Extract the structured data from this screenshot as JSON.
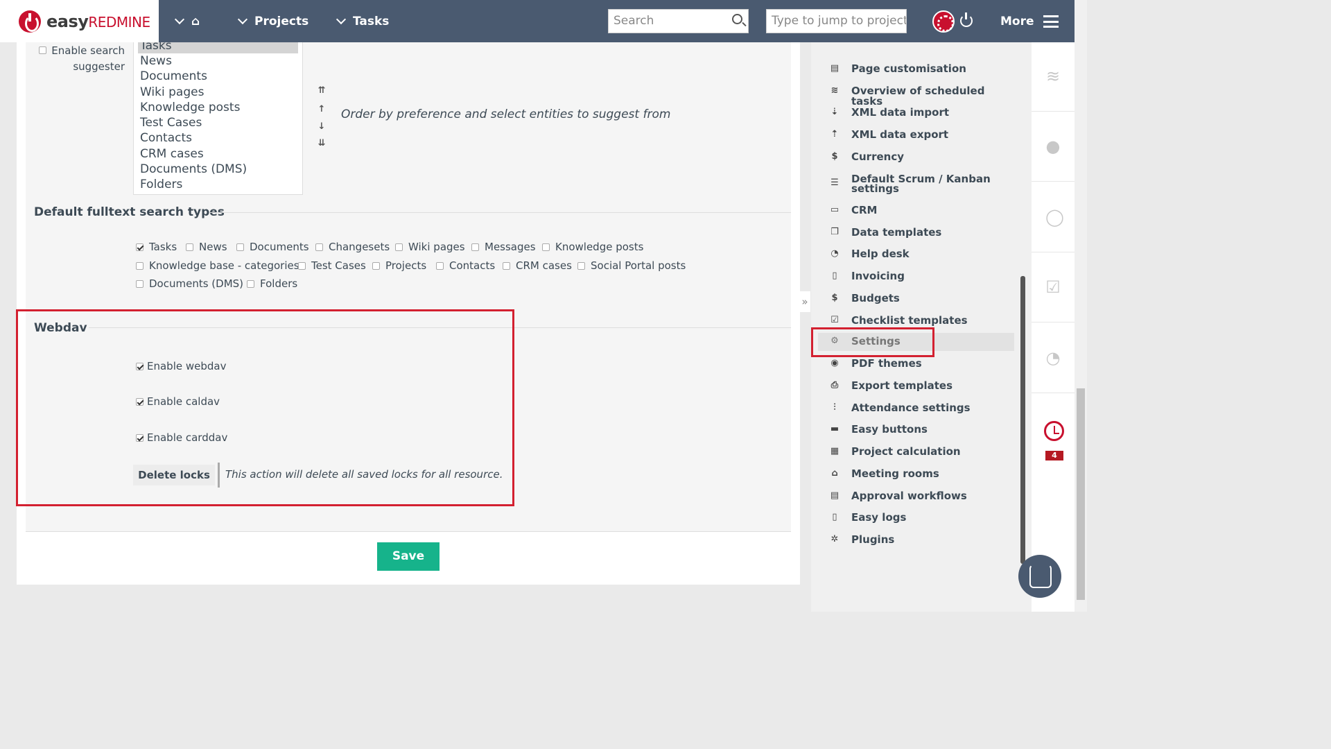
{
  "topbar": {
    "logo_brand": "easy",
    "logo_product": "REDMINE",
    "nav": [
      {
        "label": ""
      },
      {
        "label": "Projects"
      },
      {
        "label": "Tasks"
      }
    ],
    "search_placeholder": "Search",
    "jump_placeholder": "Type to jump to project",
    "more_label": "More"
  },
  "suggester": {
    "label": "Enable search suggester",
    "entities": [
      "Tasks",
      "News",
      "Documents",
      "Wiki pages",
      "Knowledge posts",
      "Test Cases",
      "Contacts",
      "CRM cases",
      "Documents (DMS)",
      "Folders"
    ],
    "selected": "Tasks",
    "order_buttons": [
      "⇈",
      "↑",
      "↓",
      "⇊"
    ],
    "hint": "Order by preference and select entities to suggest from"
  },
  "fulltext": {
    "title": "Default fulltext search types",
    "items": [
      {
        "label": "Tasks",
        "checked": true
      },
      {
        "label": "News",
        "checked": false
      },
      {
        "label": "Documents",
        "checked": false
      },
      {
        "label": "Changesets",
        "checked": false
      },
      {
        "label": "Wiki pages",
        "checked": false
      },
      {
        "label": "Messages",
        "checked": false
      },
      {
        "label": "Knowledge posts",
        "checked": false
      },
      {
        "label": "Knowledge base - categories",
        "checked": false
      },
      {
        "label": "Test Cases",
        "checked": false
      },
      {
        "label": "Projects",
        "checked": false
      },
      {
        "label": "Contacts",
        "checked": false
      },
      {
        "label": "CRM cases",
        "checked": false
      },
      {
        "label": "Social Portal posts",
        "checked": false
      },
      {
        "label": "Documents (DMS)",
        "checked": false
      },
      {
        "label": "Folders",
        "checked": false
      }
    ]
  },
  "webdav": {
    "title": "Webdav",
    "options": [
      {
        "label": "Enable webdav",
        "checked": true
      },
      {
        "label": "Enable caldav",
        "checked": true
      },
      {
        "label": "Enable carddav",
        "checked": true
      }
    ],
    "delete_label": "Delete locks",
    "delete_hint": "This action will delete all saved locks for all resource."
  },
  "save_label": "Save",
  "collapse_label": "»",
  "sidebar": {
    "items": [
      {
        "label": "Page customisation",
        "icon": "page-icon"
      },
      {
        "label": "Overview of scheduled tasks",
        "icon": "tasks-icon"
      },
      {
        "label": "XML data import",
        "icon": "download-icon"
      },
      {
        "label": "XML data export",
        "icon": "upload-icon"
      },
      {
        "label": "Currency",
        "icon": "dollar-icon"
      },
      {
        "label": "Default Scrum / Kanban settings",
        "icon": "list-icon"
      },
      {
        "label": "CRM",
        "icon": "folder-icon"
      },
      {
        "label": "Data templates",
        "icon": "copy-icon"
      },
      {
        "label": "Help desk",
        "icon": "help-icon"
      },
      {
        "label": "Invoicing",
        "icon": "invoice-icon"
      },
      {
        "label": "Budgets",
        "icon": "dollar-icon"
      },
      {
        "label": "Checklist templates",
        "icon": "checklist-icon"
      },
      {
        "label": "Settings",
        "icon": "gear-icon",
        "active": true
      },
      {
        "label": "PDF themes",
        "icon": "eye-icon"
      },
      {
        "label": "Export templates",
        "icon": "print-icon"
      },
      {
        "label": "Attendance settings",
        "icon": "sliders-icon"
      },
      {
        "label": "Easy buttons",
        "icon": "buttons-icon"
      },
      {
        "label": "Project calculation",
        "icon": "calculator-icon"
      },
      {
        "label": "Meeting rooms",
        "icon": "home-icon"
      },
      {
        "label": "Approval workflows",
        "icon": "workflow-icon"
      },
      {
        "label": "Easy logs",
        "icon": "file-icon"
      },
      {
        "label": "Plugins",
        "icon": "plugins-icon"
      }
    ]
  },
  "rail": {
    "timer_badge": "4"
  },
  "colors": {
    "topbar": "#4a5a70",
    "accent_red": "#c8102e",
    "save_green": "#16b38b",
    "highlight_red": "#d32030"
  }
}
